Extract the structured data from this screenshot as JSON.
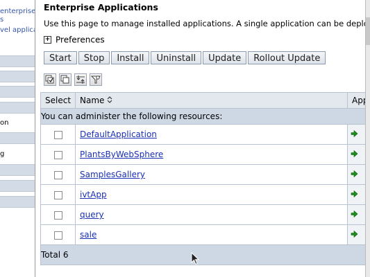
{
  "background": {
    "items": [
      "enterprise",
      "s",
      "vel applica",
      "on",
      "g"
    ]
  },
  "dialog": {
    "title": "Enterprise Applications",
    "description": "Use this page to manage installed applications. A single application can be deployed c",
    "preferences_label": "Preferences",
    "buttons": [
      "Start",
      "Stop",
      "Install",
      "Uninstall",
      "Update",
      "Rollout Update"
    ],
    "icon_buttons": [
      "select-all-icon",
      "deselect-all-icon",
      "export-icon",
      "filter-icon"
    ]
  },
  "table": {
    "headers": {
      "select": "Select",
      "name": "Name",
      "app": "App"
    },
    "info": "You can administer the following resources:",
    "rows": [
      {
        "name": "DefaultApplication"
      },
      {
        "name": "PlantsByWebSphere"
      },
      {
        "name": "SamplesGallery"
      },
      {
        "name": "ivtApp"
      },
      {
        "name": "query"
      },
      {
        "name": "sale"
      }
    ],
    "total": "Total 6"
  },
  "colors": {
    "header_bg": "#e3e8ef",
    "info_bg": "#ced8e4",
    "link": "#1a2fb3",
    "status_arrow": "#1e8c1e"
  }
}
